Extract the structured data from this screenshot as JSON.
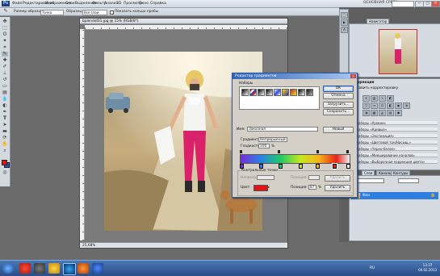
{
  "menubar": {
    "logo": "Ps",
    "items": [
      "Файл",
      "Редактирование",
      "Изображение",
      "Слои",
      "Выделение",
      "Фильтр",
      "Анализ",
      "3D",
      "Просмотр",
      "Окно",
      "Справка"
    ],
    "workspace": "ОСНОВНАЯ СРЕДА",
    "buttons": [
      "—",
      "□",
      "✕"
    ]
  },
  "options": {
    "feather_label": "Размер образца:",
    "sample_value": "Точка",
    "sample_label": "Образец:",
    "layer_value": "Все слои",
    "ring_label": "Показать кольцо пробы"
  },
  "colors": {
    "fg": "#e0141a",
    "bg": "#2450c8"
  },
  "document": {
    "title": "bplendot01.jpg @ 15% (RGB/8*)",
    "status": "25,68%"
  },
  "dialog": {
    "title": "Редактор градиентов",
    "presets_label": "Наборы",
    "ok": "ОК",
    "cancel": "Отмена",
    "load": "Загрузить...",
    "save": "Сохранить...",
    "name_label": "Имя:",
    "name_value": "Заказная",
    "new_button": "Новый",
    "type_label": "Градиент:",
    "type_value": "Непрерывный",
    "smooth_label": "Гладкость:",
    "smooth_value": "100",
    "smooth_unit": "%",
    "stops_label": "Контрольные точки",
    "opacity_label": "Непрозр.:",
    "location_label": "Позиция:",
    "delete_button": "Удалить",
    "color_label": "Цвет:",
    "color_location": "87",
    "color_unit": "%",
    "delete_button2": "Удалить"
  },
  "panels": {
    "nav_tab": "Навигатор",
    "adj_title": "Коррекция",
    "adj_label": "Добавить корректировку",
    "presets_list": [
      "Наборы «Уровни»",
      "Наборы «Кривые»",
      "Наборы «Экспозиция»",
      "Наборы «Цветовой тон/Насыщ.»",
      "Наборы «Черно-белое»",
      "Наборы «Микширование каналов»",
      "Наборы «Выборочная коррекция цвета»"
    ],
    "layers_tabs": [
      "Слои",
      "Каналы",
      "Контуры"
    ],
    "layer_name": "Фон"
  },
  "taskbar": {
    "time": "13:37",
    "date": "04.02.2013",
    "lang": "RU"
  }
}
